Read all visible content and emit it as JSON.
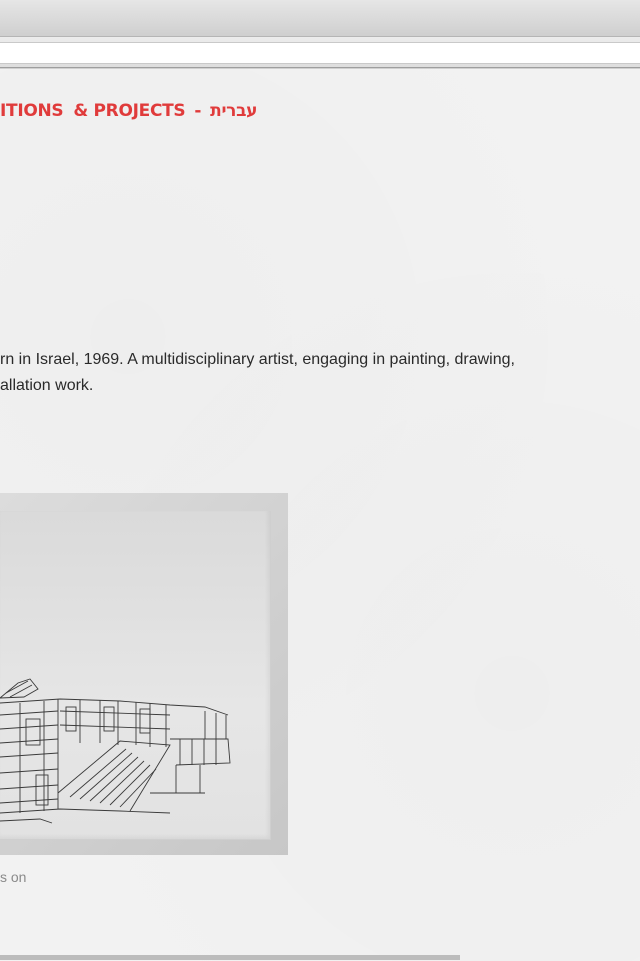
{
  "nav": {
    "items": [
      {
        "label": "ITIONS"
      },
      {
        "label": "& PROJECTS"
      }
    ],
    "separator": "-",
    "hebrew_label": "עברית"
  },
  "bio": {
    "line1": "rn in Israel, 1969. A multidisciplinary artist, engaging in painting, drawing,",
    "line2": "allation work."
  },
  "caption": {
    "text": "s on"
  },
  "colors": {
    "nav_red": "#e03b3b",
    "body_text": "#2a2a2a",
    "caption_gray": "#8a8a8a",
    "page_bg": "#f2f2f2"
  }
}
